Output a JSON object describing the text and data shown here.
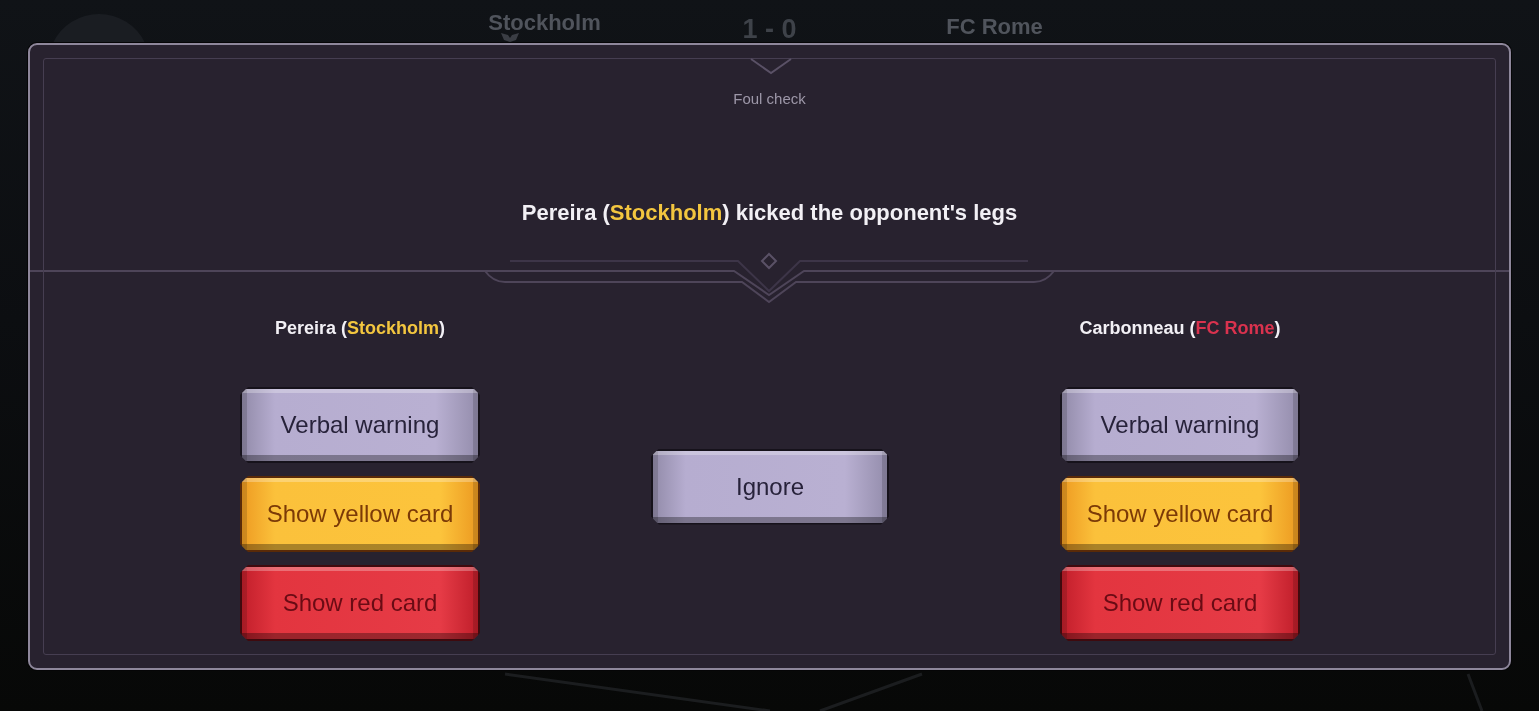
{
  "scoreboard": {
    "home_team": "Stockholm",
    "score": "1 - 0",
    "away_team": "FC Rome"
  },
  "dialog": {
    "title": "Foul check",
    "incident": [
      {
        "text": "Pereira ("
      },
      {
        "text": "Stockholm",
        "color": "#f3c63f"
      },
      {
        "text": ") kicked the opponent's legs"
      }
    ],
    "columns": [
      {
        "label": [
          {
            "text": "Pereira ("
          },
          {
            "text": "Stockholm",
            "color": "#f3c63f"
          },
          {
            "text": ")"
          }
        ],
        "actions": [
          {
            "kind": "verbal",
            "label": "Verbal warning"
          },
          {
            "kind": "yellow",
            "label": "Show yellow card"
          },
          {
            "kind": "red",
            "label": "Show red card"
          }
        ]
      },
      {
        "actions": [
          {
            "kind": "neutral",
            "label": "Ignore"
          }
        ]
      },
      {
        "label": [
          {
            "text": "Carbonneau ("
          },
          {
            "text": "FC Rome",
            "color": "#d9324e"
          },
          {
            "text": ")"
          }
        ],
        "actions": [
          {
            "kind": "verbal",
            "label": "Verbal warning"
          },
          {
            "kind": "yellow",
            "label": "Show yellow card"
          },
          {
            "kind": "red",
            "label": "Show red card"
          }
        ]
      }
    ]
  }
}
